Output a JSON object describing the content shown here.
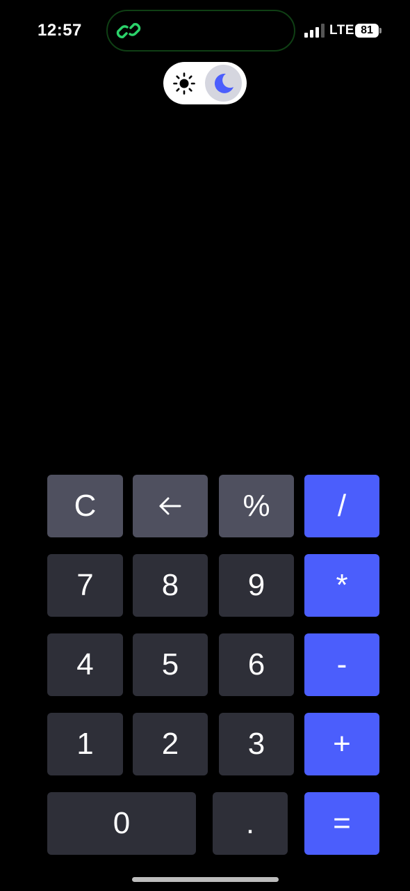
{
  "status_bar": {
    "time": "12:57",
    "network": "LTE",
    "battery": "81",
    "island_icon": "link-icon"
  },
  "theme_toggle": {
    "options": [
      "light",
      "dark"
    ],
    "selected": "dark",
    "icons": [
      "sun-icon",
      "moon-icon"
    ]
  },
  "keypad": {
    "rows": [
      [
        "C",
        "←",
        "%",
        "/"
      ],
      [
        "7",
        "8",
        "9",
        "*"
      ],
      [
        "4",
        "5",
        "6",
        "-"
      ],
      [
        "1",
        "2",
        "3",
        "+"
      ],
      [
        "0",
        ".",
        "="
      ]
    ],
    "colors": {
      "function_key": "#4f505f",
      "number_key": "#2e2f38",
      "operator_key": "#4b5efc",
      "accent_green": "#2bd26a"
    }
  }
}
